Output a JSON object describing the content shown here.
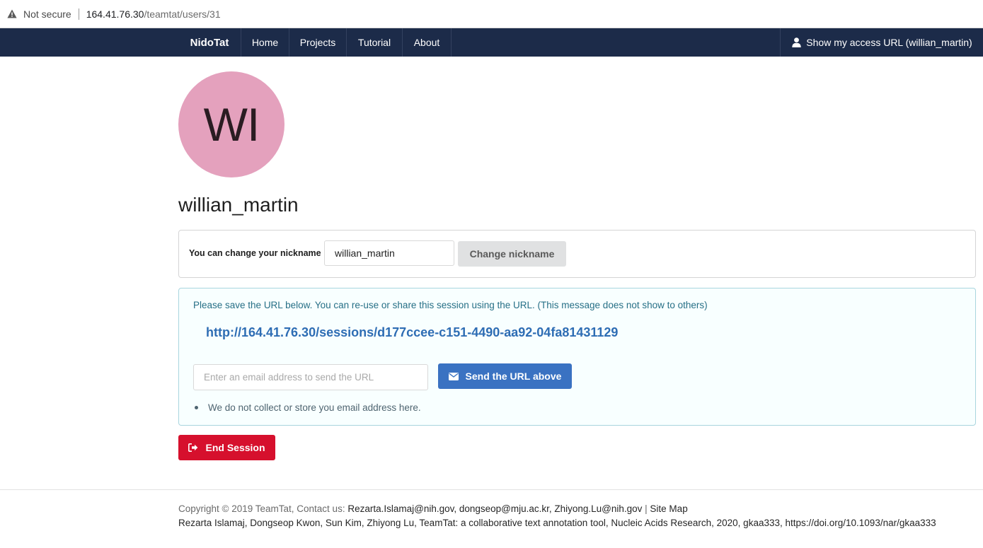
{
  "browser": {
    "security_label": "Not secure",
    "url_host": "164.41.76.30",
    "url_path": "/teamtat/users/31"
  },
  "navbar": {
    "brand": "NidoTat",
    "items": [
      {
        "label": "Home"
      },
      {
        "label": "Projects"
      },
      {
        "label": "Tutorial"
      },
      {
        "label": "About"
      }
    ],
    "access_url_label": "Show my access URL (willian_martin)"
  },
  "profile": {
    "avatar_initials": "WI",
    "avatar_color": "#e4a1bd",
    "username": "willian_martin"
  },
  "nickname": {
    "label": "You can change your nickname",
    "value": "willian_martin",
    "button_label": "Change nickname"
  },
  "session_info": {
    "message": "Please save the URL below. You can re-use or share this session using the URL. (This message does not show to others)",
    "url": "http://164.41.76.30/sessions/d177ccee-c151-4490-aa92-04fa81431129",
    "email_placeholder": "Enter an email address to send the URL",
    "send_button_label": "Send the URL above",
    "note": "We do not collect or store you email address here."
  },
  "end_session_label": "End Session",
  "footer": {
    "copyright_prefix": "Copyright © 2019 TeamTat, Contact us: ",
    "contacts": "Rezarta.Islamaj@nih.gov, dongseop@mju.ac.kr, Zhiyong.Lu@nih.gov",
    "sep": " | ",
    "sitemap": "Site Map",
    "citation": "Rezarta Islamaj, Dongseop Kwon, Sun Kim, Zhiyong Lu, TeamTat: a collaborative text annotation tool, Nucleic Acids Research, 2020, gkaa333, https://doi.org/10.1093/nar/gkaa333"
  },
  "colors": {
    "navbar_bg": "#1c2b49",
    "primary_button": "#3a72c2",
    "danger_button": "#d6102d",
    "info_text": "#276f86"
  }
}
